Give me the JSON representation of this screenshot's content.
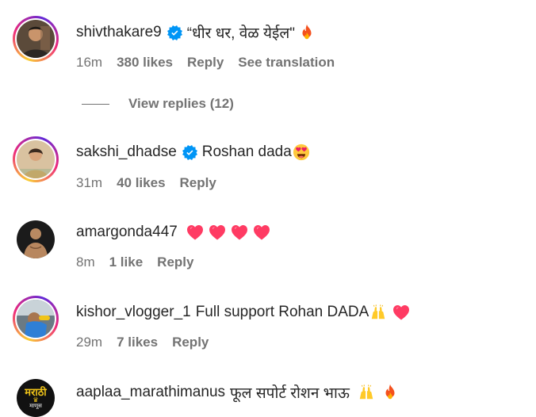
{
  "comments": [
    {
      "username": "shivthakare9",
      "verified": true,
      "text": "“धीर धर, वेळ येईल\"",
      "emoji": [
        "fire"
      ],
      "time": "16m",
      "likes": "380 likes",
      "reply": "Reply",
      "translate": "See translation",
      "story_ring": true
    },
    {
      "username": "sakshi_dhadse",
      "verified": true,
      "text": "Roshan dada",
      "emoji": [
        "heart-eyes"
      ],
      "time": "31m",
      "likes": "40 likes",
      "reply": "Reply",
      "story_ring": true
    },
    {
      "username": "amargonda447",
      "verified": false,
      "text": "",
      "emoji": [
        "heart",
        "heart",
        "heart",
        "heart"
      ],
      "time": "8m",
      "likes": "1 like",
      "reply": "Reply",
      "story_ring": false
    },
    {
      "username": "kishor_vlogger_1",
      "verified": false,
      "text": "Full support Rohan DADA",
      "emoji": [
        "praise-hands",
        "heart"
      ],
      "time": "29m",
      "likes": "7 likes",
      "reply": "Reply",
      "story_ring": true
    },
    {
      "username": "aaplaa_marathimanus",
      "verified": false,
      "text": "फूल सपोर्ट रोशन भाऊ",
      "emoji": [
        "praise-hands",
        "fire"
      ],
      "story_ring": false,
      "avatar_text": "मराठी",
      "avatar_subtext": "माणूस"
    }
  ],
  "view_replies": "View replies (12)",
  "colors": {
    "verified": "#0095f6",
    "muted": "#737373",
    "text": "#262626",
    "heart": "#ff3b63"
  }
}
